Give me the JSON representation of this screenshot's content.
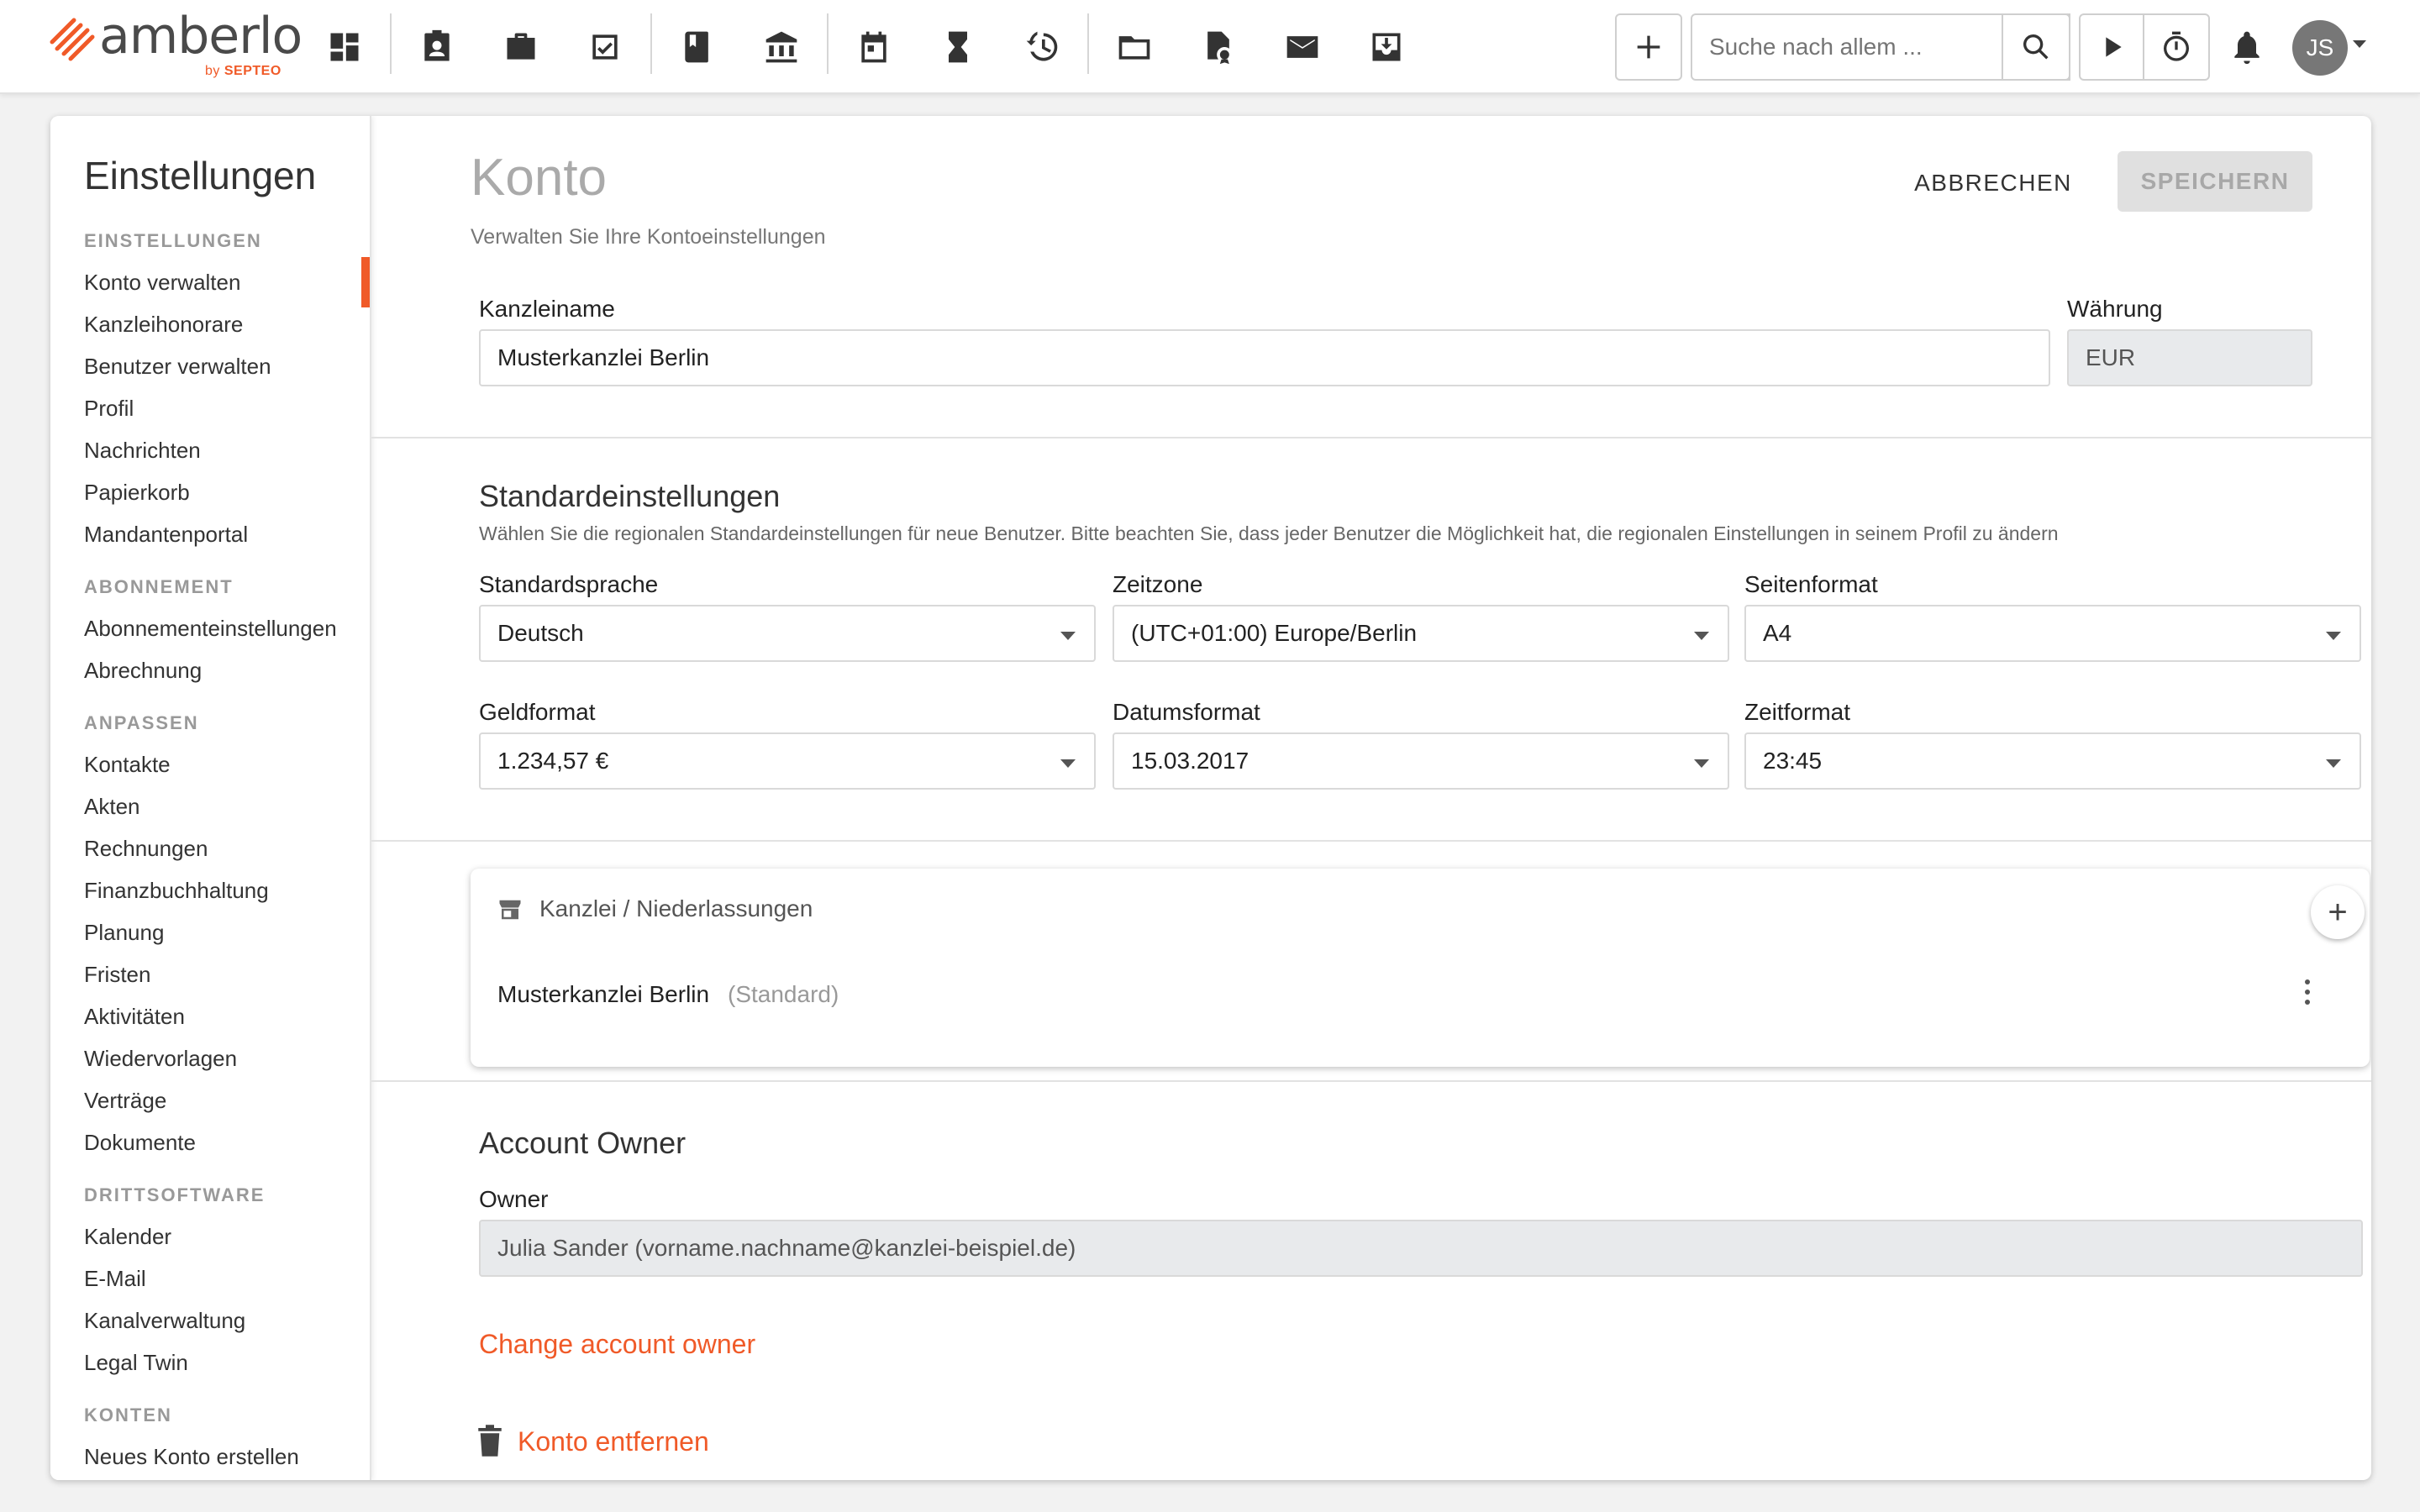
{
  "brand": {
    "name": "amberlo",
    "sub_prefix": "by",
    "sub_name": "SEPTEO",
    "accent": "#f05a28"
  },
  "toolbar": {
    "icons": [
      "dashboard-icon",
      "contact-badge-icon",
      "briefcase-icon",
      "task-check-icon",
      "book-icon",
      "bank-icon",
      "calendar-icon",
      "hourglass-icon",
      "billing-history-icon",
      "folder-icon",
      "certificate-icon",
      "mail-icon",
      "inbox-download-icon"
    ],
    "search_placeholder": "Suche nach allem ...",
    "avatar_initials": "JS"
  },
  "sidebar": {
    "title": "Einstellungen",
    "sections": [
      {
        "heading": "EINSTELLUNGEN",
        "items": [
          "Konto verwalten",
          "Kanzleihonorare",
          "Benutzer verwalten",
          "Profil",
          "Nachrichten",
          "Papierkorb",
          "Mandantenportal"
        ]
      },
      {
        "heading": "ABONNEMENT",
        "items": [
          "Abonnementeinstellungen",
          "Abrechnung"
        ]
      },
      {
        "heading": "ANPASSEN",
        "items": [
          "Kontakte",
          "Akten",
          "Rechnungen",
          "Finanzbuchhaltung",
          "Planung",
          "Fristen",
          "Aktivitäten",
          "Wiedervorlagen",
          "Verträge",
          "Dokumente"
        ]
      },
      {
        "heading": "DRITTSOFTWARE",
        "items": [
          "Kalender",
          "E-Mail",
          "Kanalverwaltung",
          "Legal Twin"
        ]
      },
      {
        "heading": "KONTEN",
        "items": [
          "Neues Konto erstellen"
        ]
      }
    ],
    "active_item": "Konto verwalten"
  },
  "page": {
    "title": "Konto",
    "subtitle": "Verwalten Sie Ihre Kontoeinstellungen",
    "cancel_label": "ABBRECHEN",
    "save_label": "SPEICHERN"
  },
  "account": {
    "firm_name_label": "Kanzleiname",
    "firm_name_value": "Musterkanzlei Berlin",
    "currency_label": "Währung",
    "currency_value": "EUR"
  },
  "defaults": {
    "title": "Standardeinstellungen",
    "description": "Wählen Sie die regionalen Standardeinstellungen für neue Benutzer. Bitte beachten Sie, dass jeder Benutzer die Möglichkeit hat, die regionalen Einstellungen in seinem Profil zu ändern",
    "language_label": "Standardsprache",
    "language_value": "Deutsch",
    "timezone_label": "Zeitzone",
    "timezone_value": "(UTC+01:00) Europe/Berlin",
    "pageformat_label": "Seitenformat",
    "pageformat_value": "A4",
    "moneyformat_label": "Geldformat",
    "moneyformat_value": "1.234,57 €",
    "dateformat_label": "Datumsformat",
    "dateformat_value": "15.03.2017",
    "timeformat_label": "Zeitformat",
    "timeformat_value": "23:45"
  },
  "branches": {
    "heading": "Kanzlei / Niederlassungen",
    "add_label": "+",
    "items": [
      {
        "name": "Musterkanzlei Berlin",
        "tag": "(Standard)"
      }
    ]
  },
  "owner": {
    "title": "Account Owner",
    "label": "Owner",
    "value": "Julia Sander (vorname.nachname@kanzlei-beispiel.de)",
    "change_link": "Change account owner",
    "remove_link": "Konto entfernen"
  }
}
